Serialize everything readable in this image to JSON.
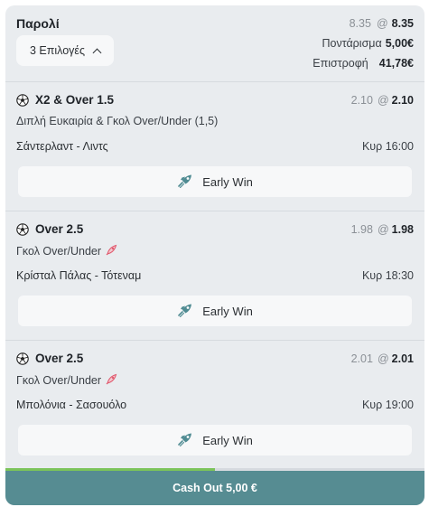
{
  "slip": {
    "title": "Παρολί",
    "selections_label": "3 Επιλογές",
    "odds_old": "8.35",
    "odds_new": "8.35",
    "stake_label": "Ποντάρισμα",
    "stake_value": "5,00€",
    "return_label": "Επιστροφή",
    "return_value": "41,78€"
  },
  "at_symbol": "@",
  "bets": [
    {
      "selection": "X2 & Over 1.5",
      "market": "Διπλή Ευκαιρία & Γκολ Over/Under (1,5)",
      "odds_old": "2.10",
      "odds_new": "2.10",
      "match": "Σάντερλαντ - Λιντς",
      "time": "Κυρ 16:00",
      "early_win_label": "Early Win",
      "has_boost_icon": false
    },
    {
      "selection": "Over 2.5",
      "market": "Γκολ Over/Under",
      "odds_old": "1.98",
      "odds_new": "1.98",
      "match": "Κρίσταλ Πάλας - Τότεναμ",
      "time": "Κυρ 18:30",
      "early_win_label": "Early Win",
      "has_boost_icon": true
    },
    {
      "selection": "Over 2.5",
      "market": "Γκολ Over/Under",
      "odds_old": "2.01",
      "odds_new": "2.01",
      "match": "Μπολόνια - Σασουόλο",
      "time": "Κυρ 19:00",
      "early_win_label": "Early Win",
      "has_boost_icon": true
    }
  ],
  "cashout": {
    "label": "Cash Out 5,00 €",
    "progress_fraction": 0.5
  },
  "colors": {
    "card_bg": "#e9ecef",
    "button_bg": "#f7f8f9",
    "cashout_bg": "#568c92",
    "progress": "#7bc35a",
    "rocket": "#e0566b",
    "early_win_icon": "#4f8b92"
  },
  "icons": {
    "selections_toggle": "chevron-up-icon",
    "sport": "soccer-ball-icon",
    "boost": "rocket-icon",
    "early_win": "early-win-icon"
  }
}
